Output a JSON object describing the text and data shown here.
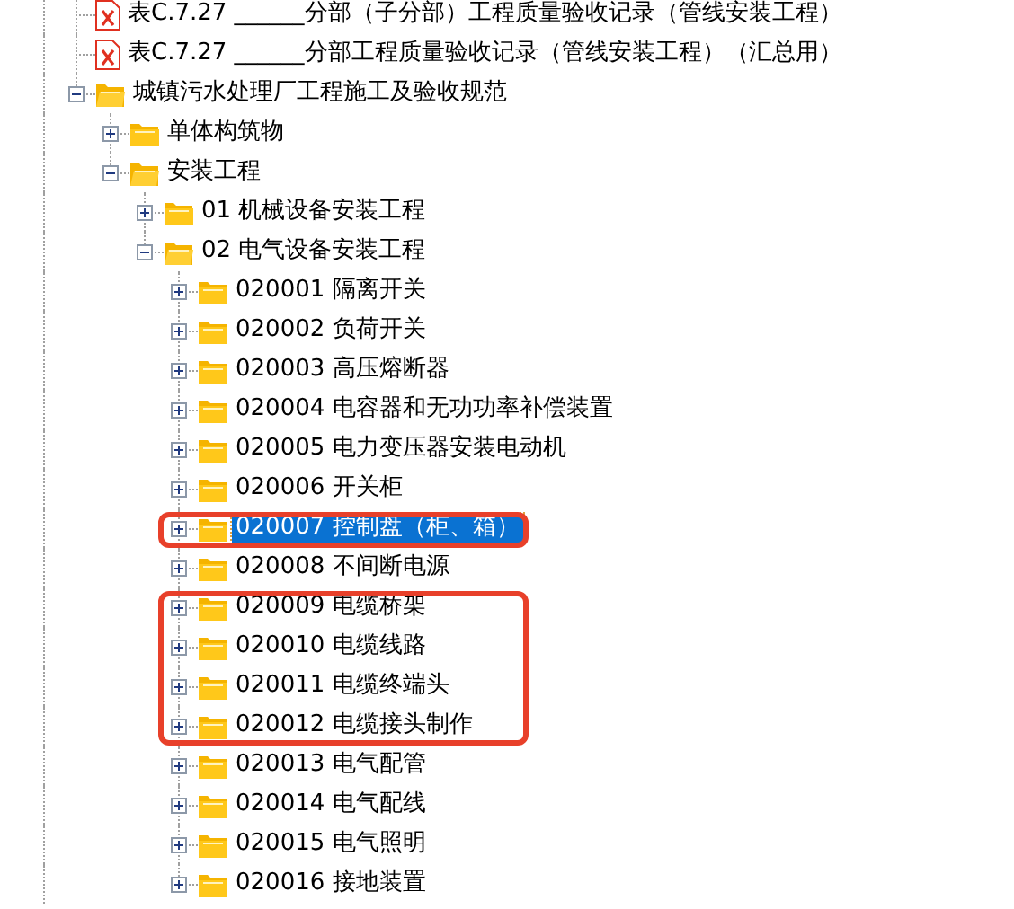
{
  "tree": [
    {
      "kind": "file",
      "label": "表C.7.27 ______分部（子分部）工程质量验收记录（管线安装工程）",
      "selected": false
    },
    {
      "kind": "file",
      "label": "表C.7.27 ______分部工程质量验收记录（管线安装工程）（汇总用）",
      "selected": false
    },
    {
      "kind": "folder",
      "label": "城镇污水处理厂工程施工及验收规范",
      "expanded": true,
      "selected": false,
      "children": [
        {
          "kind": "folder",
          "label": "单体构筑物",
          "expanded": false,
          "selected": false
        },
        {
          "kind": "folder",
          "label": "安装工程",
          "expanded": true,
          "selected": false,
          "children": [
            {
              "kind": "folder",
              "label": "01 机械设备安装工程",
              "expanded": false,
              "selected": false
            },
            {
              "kind": "folder",
              "label": "02 电气设备安装工程",
              "expanded": true,
              "selected": false,
              "children": [
                {
                  "kind": "folder",
                  "label": "020001 隔离开关",
                  "expanded": false,
                  "selected": false,
                  "outlined": false
                },
                {
                  "kind": "folder",
                  "label": "020002 负荷开关",
                  "expanded": false,
                  "selected": false,
                  "outlined": false
                },
                {
                  "kind": "folder",
                  "label": "020003 高压熔断器",
                  "expanded": false,
                  "selected": false,
                  "outlined": false
                },
                {
                  "kind": "folder",
                  "label": "020004 电容器和无功功率补偿装置",
                  "expanded": false,
                  "selected": false,
                  "outlined": false
                },
                {
                  "kind": "folder",
                  "label": "020005 电力变压器安装电动机",
                  "expanded": false,
                  "selected": false,
                  "outlined": false
                },
                {
                  "kind": "folder",
                  "label": "020006 开关柜",
                  "expanded": false,
                  "selected": false,
                  "outlined": false
                },
                {
                  "kind": "folder",
                  "label": "020007 控制盘（柜、箱）",
                  "expanded": false,
                  "selected": true,
                  "outlined": true
                },
                {
                  "kind": "folder",
                  "label": "020008 不间断电源",
                  "expanded": false,
                  "selected": false,
                  "outlined": false
                },
                {
                  "kind": "folder",
                  "label": "020009 电缆桥架",
                  "expanded": false,
                  "selected": false,
                  "outlined": true
                },
                {
                  "kind": "folder",
                  "label": "020010 电缆线路",
                  "expanded": false,
                  "selected": false,
                  "outlined": true
                },
                {
                  "kind": "folder",
                  "label": "020011 电缆终端头",
                  "expanded": false,
                  "selected": false,
                  "outlined": true
                },
                {
                  "kind": "folder",
                  "label": "020012 电缆接头制作",
                  "expanded": false,
                  "selected": false,
                  "outlined": true
                },
                {
                  "kind": "folder",
                  "label": "020013 电气配管",
                  "expanded": false,
                  "selected": false,
                  "outlined": false
                },
                {
                  "kind": "folder",
                  "label": "020014 电气配线",
                  "expanded": false,
                  "selected": false,
                  "outlined": false
                },
                {
                  "kind": "folder",
                  "label": "020015 电气照明",
                  "expanded": false,
                  "selected": false,
                  "outlined": false
                },
                {
                  "kind": "folder",
                  "label": "020016 接地装置",
                  "expanded": false,
                  "selected": false,
                  "outlined": false
                }
              ]
            }
          ]
        }
      ]
    }
  ]
}
